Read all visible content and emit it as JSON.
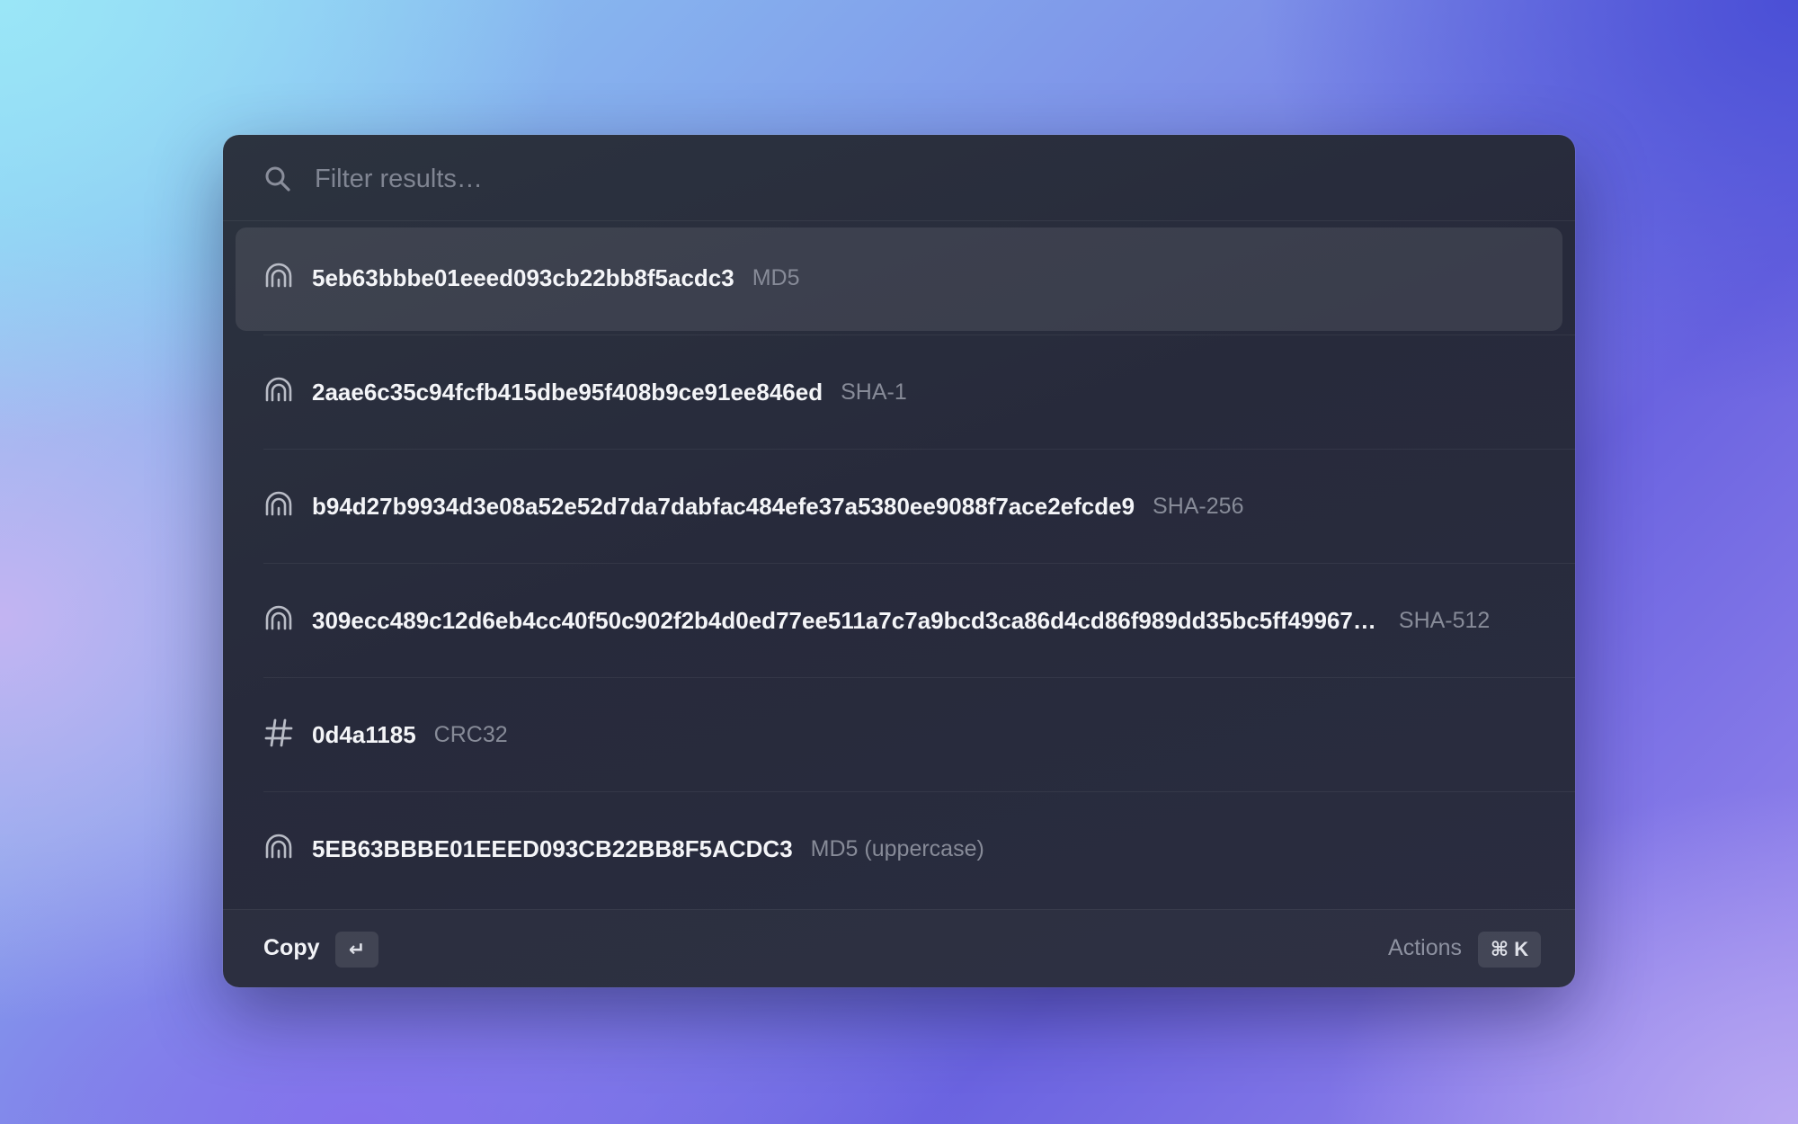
{
  "search": {
    "placeholder": "Filter results…",
    "icon": "search-icon"
  },
  "results": [
    {
      "value": "5eb63bbbe01eeed093cb22bb8f5acdc3",
      "kind": "MD5",
      "icon": "fingerprint-icon",
      "selected": true
    },
    {
      "value": "2aae6c35c94fcfb415dbe95f408b9ce91ee846ed",
      "kind": "SHA-1",
      "icon": "fingerprint-icon",
      "selected": false
    },
    {
      "value": "b94d27b9934d3e08a52e52d7da7dabfac484efe37a5380ee9088f7ace2efcde9",
      "kind": "SHA-256",
      "icon": "fingerprint-icon",
      "selected": false
    },
    {
      "value": "309ecc489c12d6eb4cc40f50c902f2b4d0ed77ee511a7c7a9bcd3ca86d4cd86f989dd35bc5ff49967…",
      "kind": "SHA-512",
      "icon": "fingerprint-icon",
      "selected": false
    },
    {
      "value": "0d4a1185",
      "kind": "CRC32",
      "icon": "hash-icon",
      "selected": false
    },
    {
      "value": "5EB63BBBE01EEED093CB22BB8F5ACDC3",
      "kind": "MD5 (uppercase)",
      "icon": "fingerprint-icon",
      "selected": false
    }
  ],
  "footer": {
    "primary_action": "Copy",
    "primary_key": "↵",
    "actions_label": "Actions",
    "actions_key": "⌘ K"
  },
  "colors": {
    "panel": "#2a2e3d",
    "selected_row": "#3b3f50",
    "text_primary": "#f4f5f8",
    "text_secondary": "#878b98"
  }
}
